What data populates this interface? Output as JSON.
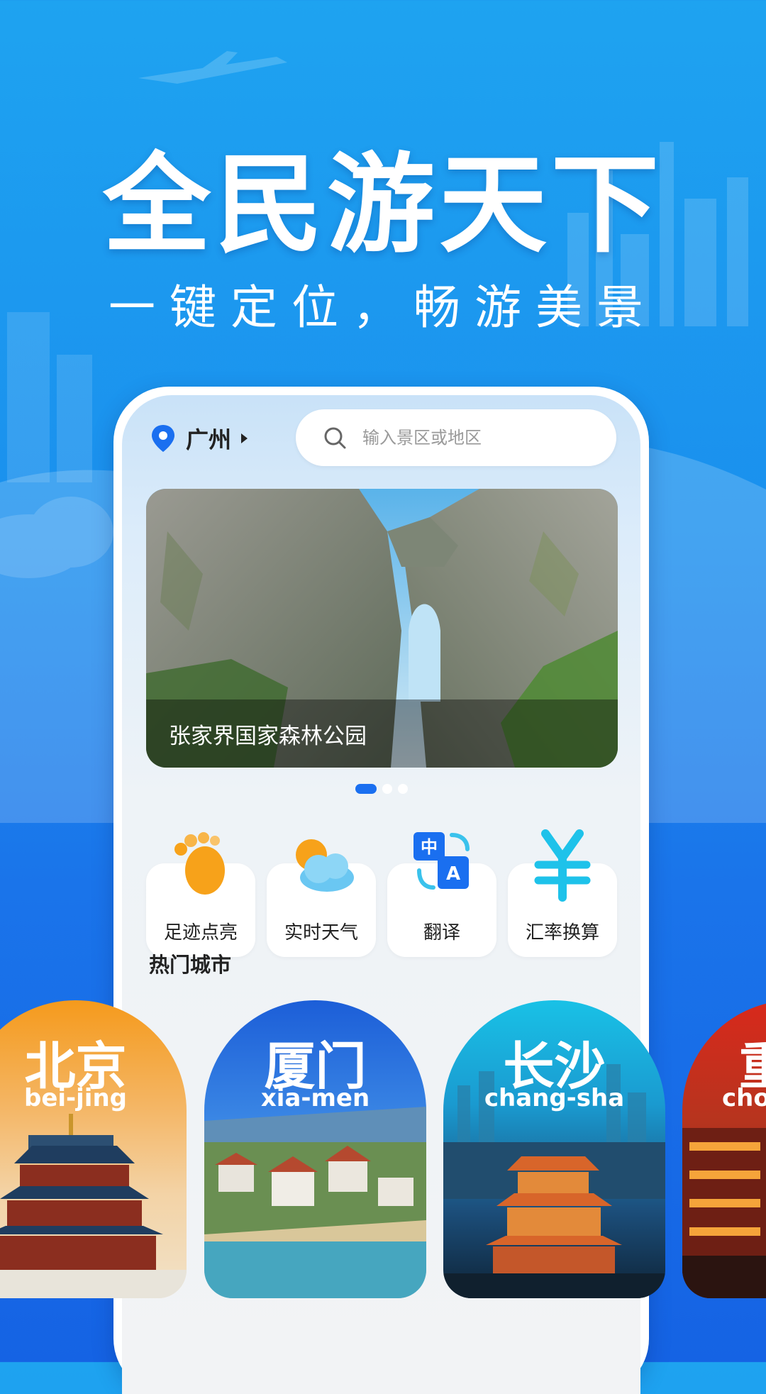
{
  "colors": {
    "brand_blue": "#1a74ea",
    "accent_orange": "#f7a21a",
    "text_dark": "#222222"
  },
  "hero": {
    "title": "全民游天下",
    "subtitle": "一键定位，畅游美景"
  },
  "app": {
    "location": {
      "icon": "location-pin-icon",
      "city": "广州"
    },
    "search": {
      "icon": "search-icon",
      "placeholder": "输入景区或地区"
    },
    "banner": {
      "caption": "张家界国家森林公园",
      "page_index": 1,
      "page_count": 3
    },
    "features": [
      {
        "label": "足迹点亮",
        "icon": "footprint-icon"
      },
      {
        "label": "实时天气",
        "icon": "weather-icon"
      },
      {
        "label": "翻译",
        "icon": "translate-icon"
      },
      {
        "label": "汇率换算",
        "icon": "currency-yuan-icon"
      }
    ],
    "hot_cities_title": "热门城市",
    "cities": [
      {
        "name": "北京",
        "pinyin": "bei-jing"
      },
      {
        "name": "厦门",
        "pinyin": "xia-men"
      },
      {
        "name": "长沙",
        "pinyin": "chang-sha"
      },
      {
        "name": "重",
        "pinyin": "cho"
      }
    ]
  }
}
